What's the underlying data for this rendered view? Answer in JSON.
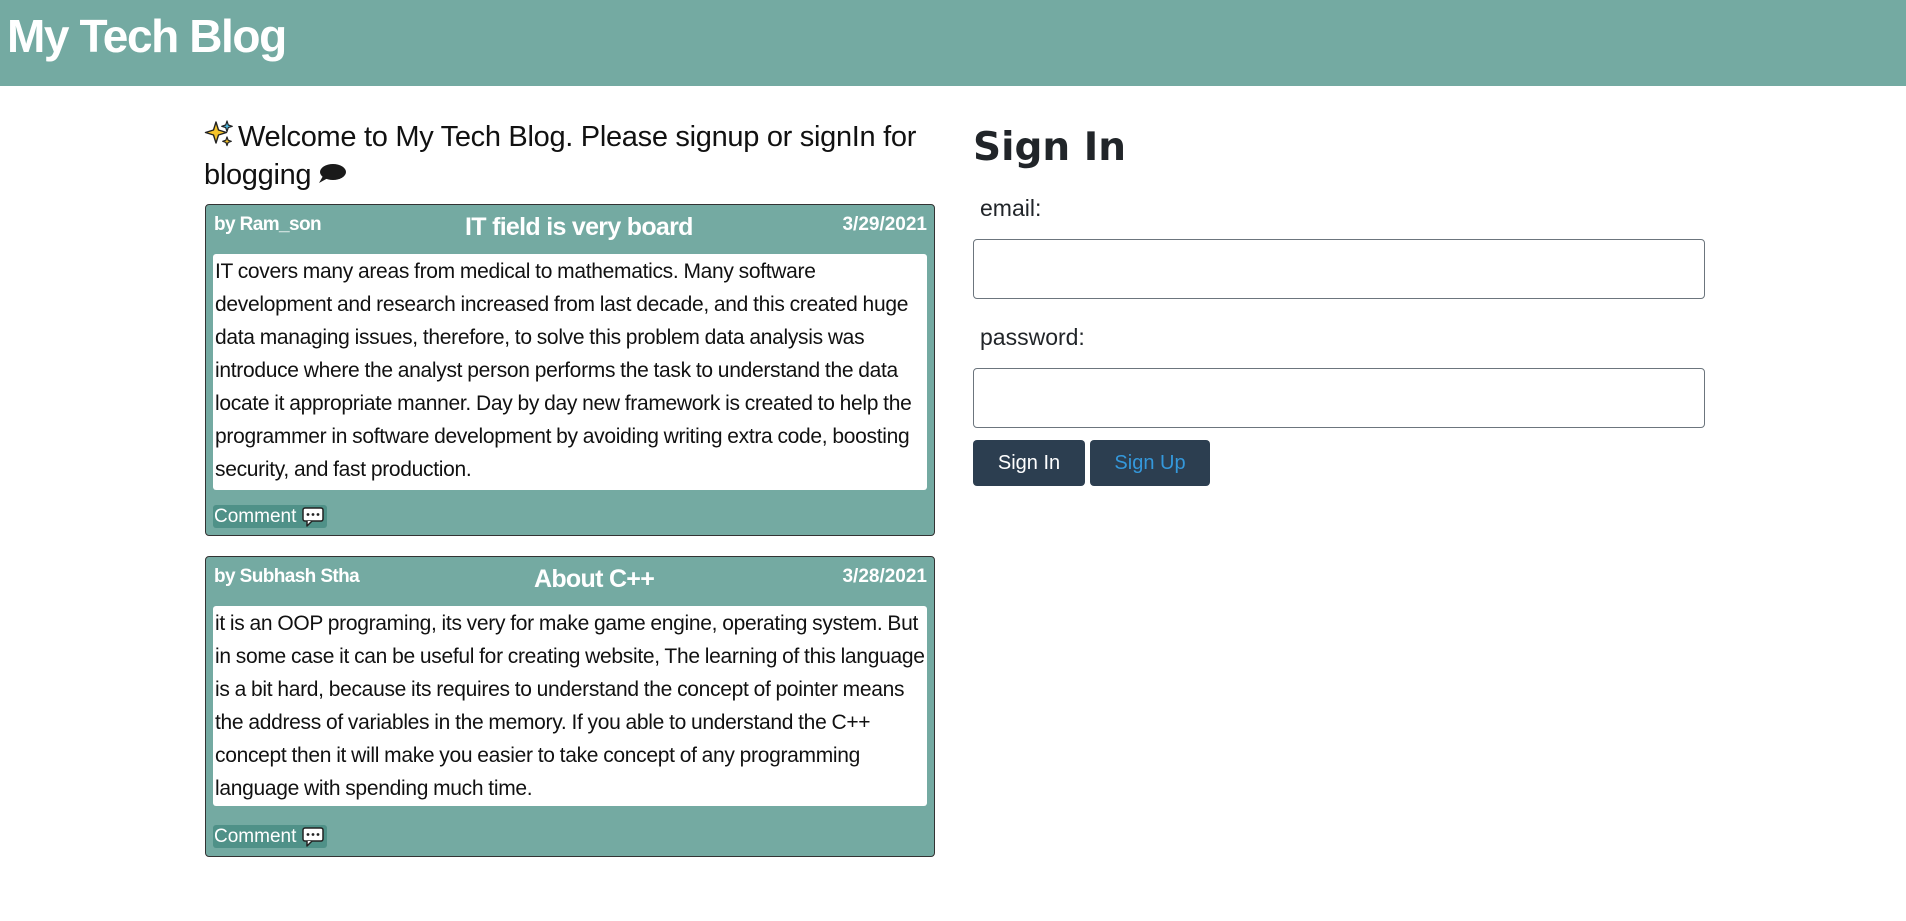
{
  "header": {
    "title": "My Tech Blog"
  },
  "welcome": {
    "text": "Welcome to My Tech Blog. Please signup or signIn for blogging",
    "leading_icon": "sparkles-icon",
    "trailing_icon": "speech-bubble-icon"
  },
  "posts": [
    {
      "author": "by Ram_son",
      "title": "IT field is very board",
      "date": "3/29/2021",
      "body": "IT covers many areas from medical to mathematics. Many software development and research increased from last decade, and this created huge data managing issues, therefore, to solve this problem data analysis was introduce where the analyst person performs the task to understand the data locate it appropriate manner. Day by day new framework is created to help the programmer in software development by avoiding writing extra code, boosting security, and fast production.",
      "comment_label": "Comment",
      "comment_icon": "comment-bubble-icon"
    },
    {
      "author": "by Subhash Stha",
      "title": "About C++",
      "date": "3/28/2021",
      "body": "it is an OOP programing, its very for make game engine, operating system. But in some case it can be useful for creating website, The learning of this language is a bit hard, because its requires to understand the concept of pointer means the address of variables in the memory. If you able to understand the C++ concept then it will make you easier to take concept of any programming language with spending much time.",
      "comment_label": "Comment",
      "comment_icon": "comment-bubble-icon"
    }
  ],
  "signin": {
    "title": "Sign In",
    "email_label": "email:",
    "email_value": "",
    "password_label": "password:",
    "password_value": "",
    "signin_button": "Sign In",
    "signup_button": "Sign Up"
  },
  "colors": {
    "header_bg": "#74aaa2",
    "post_bg": "#74aaa2",
    "comment_bg": "#4f9188",
    "button_bg": "#2c3e50",
    "signup_text": "#3498db"
  }
}
